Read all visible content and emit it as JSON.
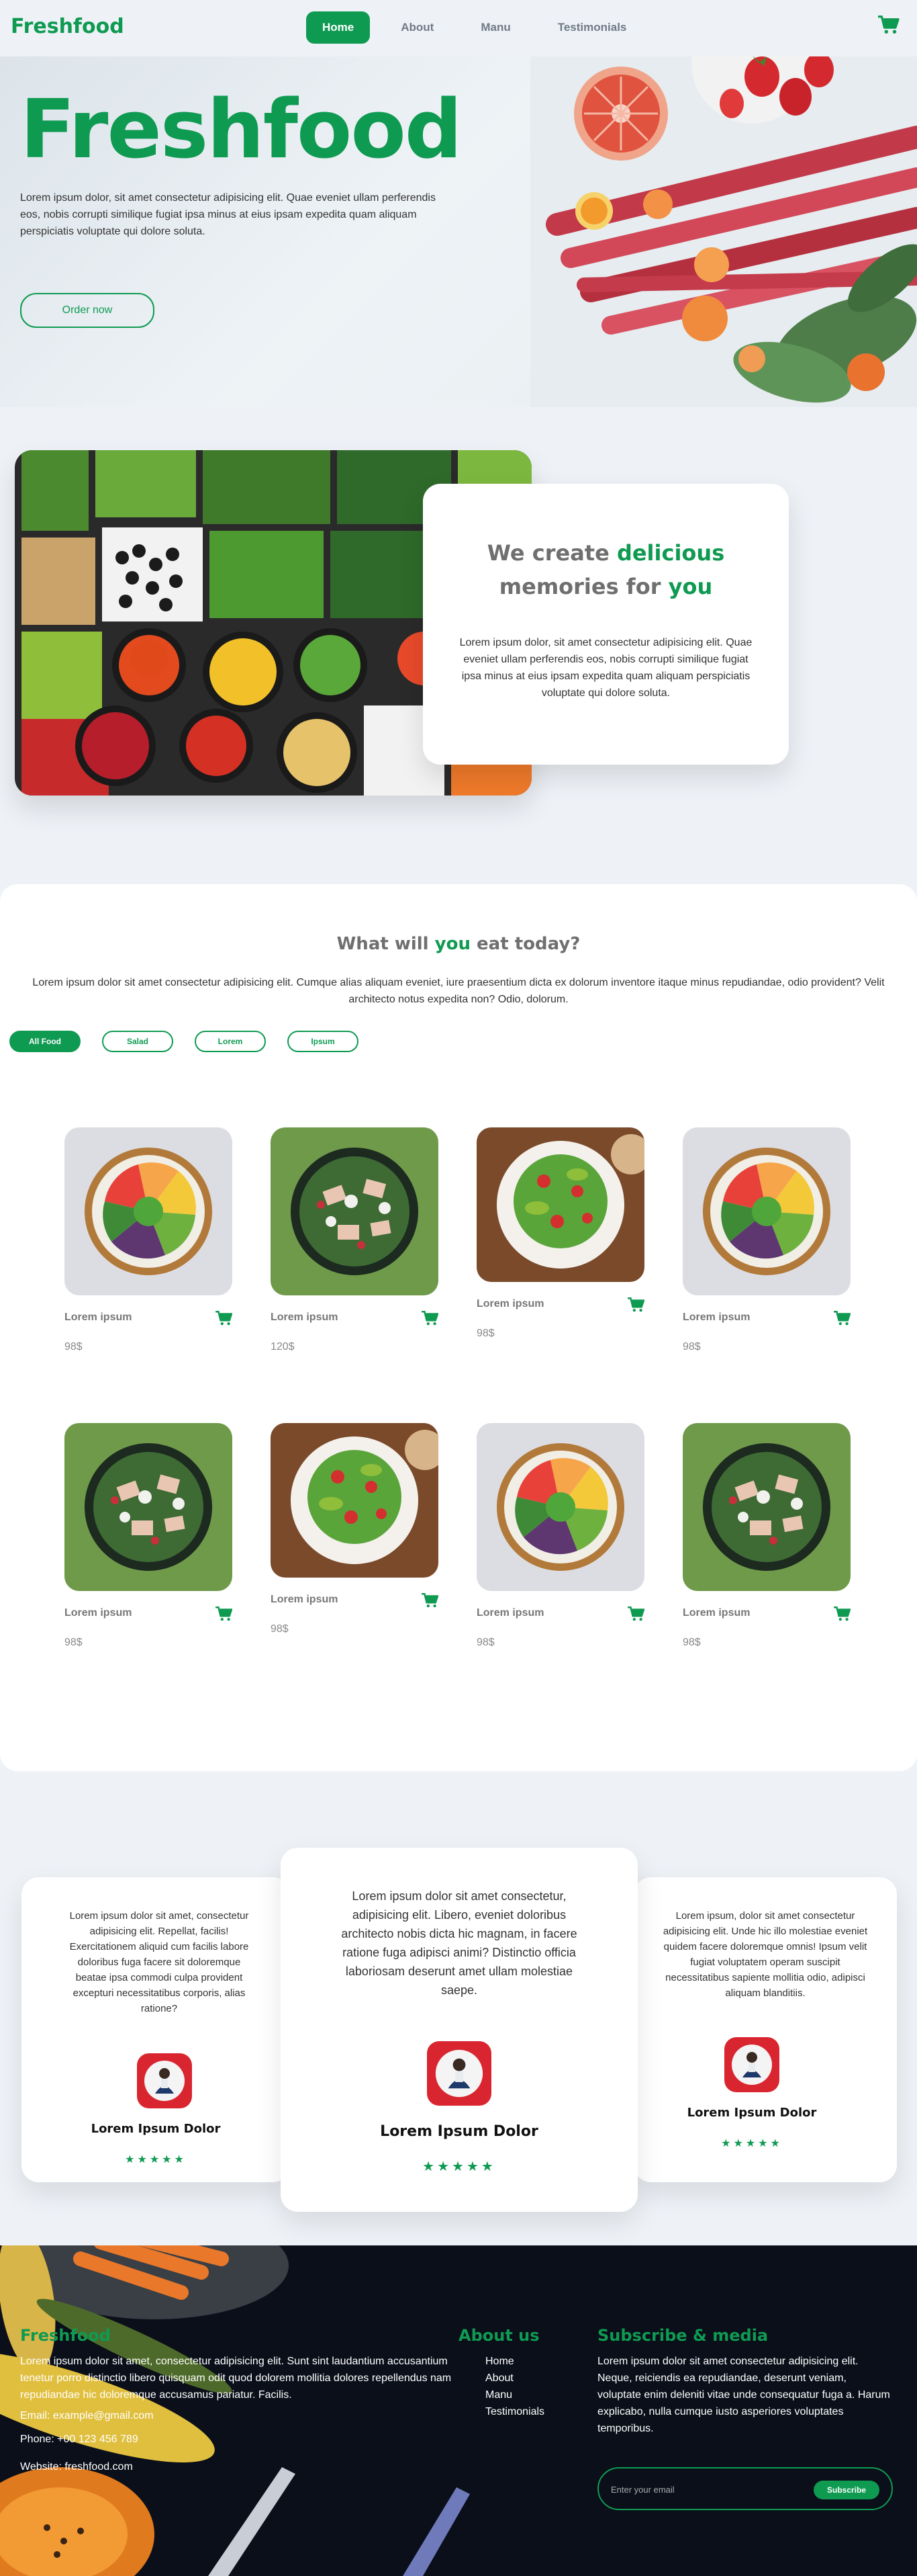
{
  "brand": "Freshfood",
  "colors": {
    "accent": "#0f9a52",
    "footer_bg": "#0a0f1a",
    "page_bg": "#eef2f7"
  },
  "nav": {
    "items": [
      {
        "label": "Home",
        "active": true
      },
      {
        "label": "About",
        "active": false
      },
      {
        "label": "Manu",
        "active": false
      },
      {
        "label": "Testimonials",
        "active": false
      }
    ],
    "cart_icon": "cart-icon"
  },
  "hero": {
    "title": "Freshfood",
    "text": "Lorem ipsum dolor, sit amet consectetur adipisicing elit. Quae eveniet ullam perferendis eos, nobis corrupti similique fugiat ipsa minus at eius ipsam expedita quam aliquam perspiciatis voluptate qui dolore soluta.",
    "button": "Order now"
  },
  "about": {
    "title_part1": "We create ",
    "title_part2": "delicious",
    "title_part3": "memories for ",
    "title_part4": "you",
    "text": "Lorem ipsum dolor, sit amet consectetur adipisicing elit. Quae eveniet ullam perferendis eos, nobis corrupti similique fugiat ipsa minus at eius ipsam expedita quam aliquam perspiciatis voluptate qui dolore soluta."
  },
  "menu_section": {
    "title_part1": "What will ",
    "title_part2": "you",
    "title_part3": " eat today?",
    "text": "Lorem ipsum dolor sit amet consectetur adipisicing elit. Cumque alias aliquam eveniet, iure praesentium dicta ex dolorum inventore itaque minus repudiandae, odio provident? Velit architecto notus expedita non? Odio, dolorum.",
    "filters": [
      {
        "label": "All Food",
        "active": true
      },
      {
        "label": "Salad",
        "active": false
      },
      {
        "label": "Lorem",
        "active": false
      },
      {
        "label": "Ipsum",
        "active": false
      }
    ],
    "items": [
      {
        "name": "Lorem ipsum",
        "price": "98$"
      },
      {
        "name": "Lorem ipsum",
        "price": "120$"
      },
      {
        "name": "Lorem ipsum",
        "price": "98$"
      },
      {
        "name": "Lorem ipsum",
        "price": "98$"
      },
      {
        "name": "Lorem ipsum",
        "price": "98$"
      },
      {
        "name": "Lorem ipsum",
        "price": "98$"
      },
      {
        "name": "Lorem ipsum",
        "price": "98$"
      },
      {
        "name": "Lorem ipsum",
        "price": "98$"
      }
    ]
  },
  "testimonials": [
    {
      "text": "Lorem ipsum dolor sit amet, consectetur adipisicing elit. Repellat, facilis! Exercitationem aliquid cum facilis labore doloribus fuga facere sit doloremque beatae ipsa commodi culpa provident excepturi necessitatibus corporis, alias ratione?",
      "name": "Lorem Ipsum Dolor",
      "stars": "★★★★★"
    },
    {
      "text": "Lorem ipsum dolor sit amet consectetur, adipisicing elit. Libero, eveniet doloribus architecto nobis dicta hic magnam, in facere ratione fuga adipisci animi? Distinctio officia laboriosam deserunt amet ullam molestiae saepe.",
      "name": "Lorem Ipsum Dolor",
      "stars": "★★★★★"
    },
    {
      "text": "Lorem ipsum, dolor sit amet consectetur adipisicing elit. Unde hic illo molestiae eveniet quidem facere doloremque omnis! Ipsum velit fugiat voluptatem operam suscipit necessitatibus sapiente mollitia odio, adipisci aliquam blanditiis.",
      "name": "Lorem Ipsum Dolor",
      "stars": "★★★★★"
    }
  ],
  "footer": {
    "brand": "Freshfood",
    "text": "Lorem ipsum dolor sit amet, consectetur adipisicing elit. Sunt sint laudantium accusantium tenetur porro distinctio libero quisquam odit quod dolorem mollitia dolores repellendus nam repudiandae hic doloremque accusamus pariatur. Facilis.",
    "email": "Email: example@gmail.com",
    "phone": "Phone: +00 123 456 789",
    "website": "Website: freshfood.com",
    "about_title": "About us",
    "links": [
      "Home",
      "About",
      "Manu",
      "Testimonials"
    ],
    "subscribe_title": "Subscribe & media",
    "subscribe_text": "Lorem ipsum dolor sit amet consectetur adipisicing elit. Neque, reiciendis ea repudiandae, deserunt veniam, voluptate enim deleniti vitae unde consequatur fuga a. Harum explicabo, nulla cumque iusto asperiores voluptates temporibus.",
    "email_placeholder": "Enter your email",
    "subscribe_button": "Subscribe"
  }
}
